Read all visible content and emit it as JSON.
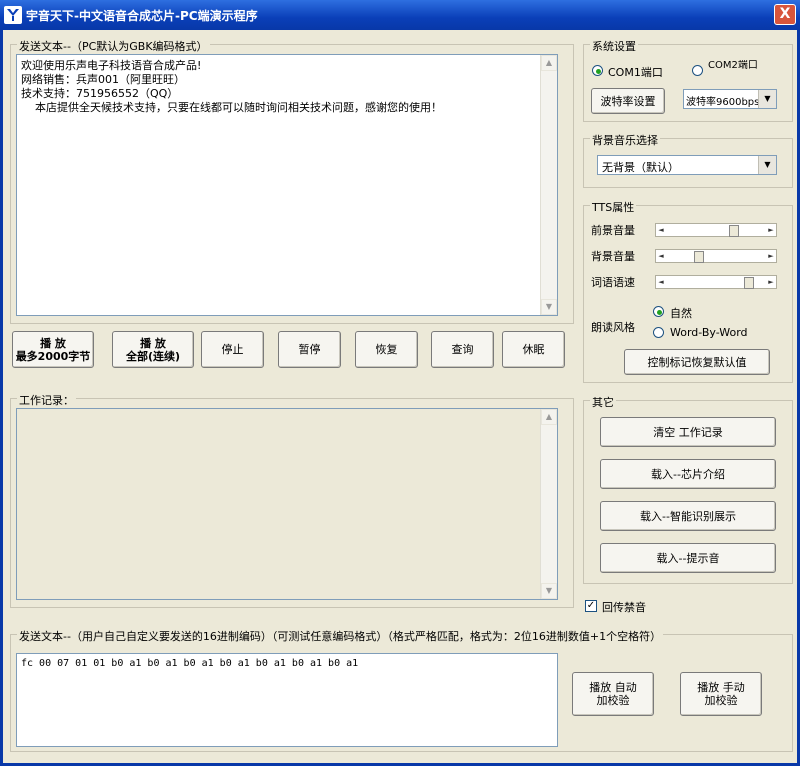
{
  "window": {
    "title": "宇音天下-中文语音合成芯片-PC端演示程序",
    "close_label": "X"
  },
  "send_text": {
    "group_label": "发送文本--（PC默认为GBK编码格式）",
    "lines": [
      "欢迎使用乐声电子科技语音合成产品!",
      "网络销售：兵声001（阿里旺旺）",
      "技术支持：751956552（QQ）",
      "    本店提供全天候技术支持，只要在线都可以随时询问相关技术问题，感谢您的使用！"
    ]
  },
  "buttons": {
    "play_max_line1": "播  放",
    "play_max_line2": "最多2000字节",
    "play_all_line1": "播  放",
    "play_all_line2": "全部(连续)",
    "stop": "停止",
    "pause": "暂停",
    "resume": "恢复",
    "query": "查询",
    "sleep": "休眠"
  },
  "work_log": {
    "group_label": "工作记录："
  },
  "system_settings": {
    "group_label": "系统设置",
    "com1_label": "COM1端口",
    "com2_label": "COM2端口",
    "com1_selected": true,
    "baud_button": "波特率设置",
    "baud_select_value": "波特率9600bps"
  },
  "bg_music": {
    "group_label": "背景音乐选择",
    "select_value": "无背景（默认）"
  },
  "tts": {
    "group_label": "TTS属性",
    "foreground_volume_label": "前景音量",
    "background_volume_label": "背景音量",
    "speech_rate_label": "词语语速",
    "foreground_volume_level": 0.68,
    "background_volume_level": 0.3,
    "speech_rate_level": 0.85,
    "reading_style_label": "朗读风格",
    "style_natural_label": "自然",
    "style_word_label": "Word-By-Word",
    "natural_selected": true,
    "restore_defaults_button": "控制标记恢复默认值"
  },
  "other": {
    "group_label": "其它",
    "clear_log_button": "清空  工作记录",
    "load_chip_intro_button": "载入--芯片介绍",
    "load_smart_demo_button": "载入--智能识别展示",
    "load_prompt_tone_button": "载入--提示音"
  },
  "echo_checkbox": {
    "label": "回传禁音",
    "checked": true
  },
  "hex_send": {
    "group_label": "发送文本--（用户自己自定义要发送的16进制编码）（可测试任意编码格式）（格式严格匹配，格式为：2位16进制数值+1个空格符）",
    "value": "fc 00 07 01 01 b0 a1 b0 a1 b0 a1 b0 a1 b0 a1 b0 a1 b0 a1",
    "auto_check_line1": "播放  自动",
    "auto_check_line2": "加校验",
    "manual_check_line1": "播放  手动",
    "manual_check_line2": "加校验"
  },
  "colors": {
    "title_bar": "#0a3fb8",
    "window_bg": "#ece9d8",
    "close_button": "#d8553c",
    "radio_dot": "#21a121"
  }
}
